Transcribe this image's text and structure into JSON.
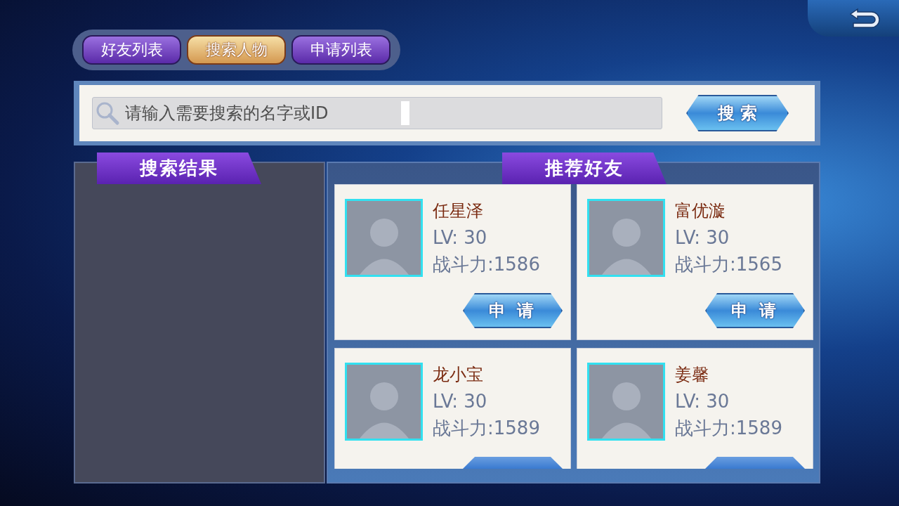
{
  "tabs": [
    {
      "label": "好友列表",
      "selected": false
    },
    {
      "label": "搜索人物",
      "selected": true
    },
    {
      "label": "申请列表",
      "selected": false
    }
  ],
  "search": {
    "placeholder": "请输入需要搜索的名字或ID",
    "button": "搜 索"
  },
  "search_results": {
    "title": "搜索结果"
  },
  "recommended": {
    "title": "推荐好友",
    "players": [
      {
        "name": "任星泽",
        "level": "LV: 30",
        "power": "战斗力:1586",
        "button": "申 请"
      },
      {
        "name": "富优漩",
        "level": "LV: 30",
        "power": "战斗力:1565",
        "button": "申 请"
      },
      {
        "name": "龙小宝",
        "level": "LV: 30",
        "power": "战斗力:1589"
      },
      {
        "name": "姜馨",
        "level": "LV: 30",
        "power": "战斗力:1589"
      }
    ]
  }
}
